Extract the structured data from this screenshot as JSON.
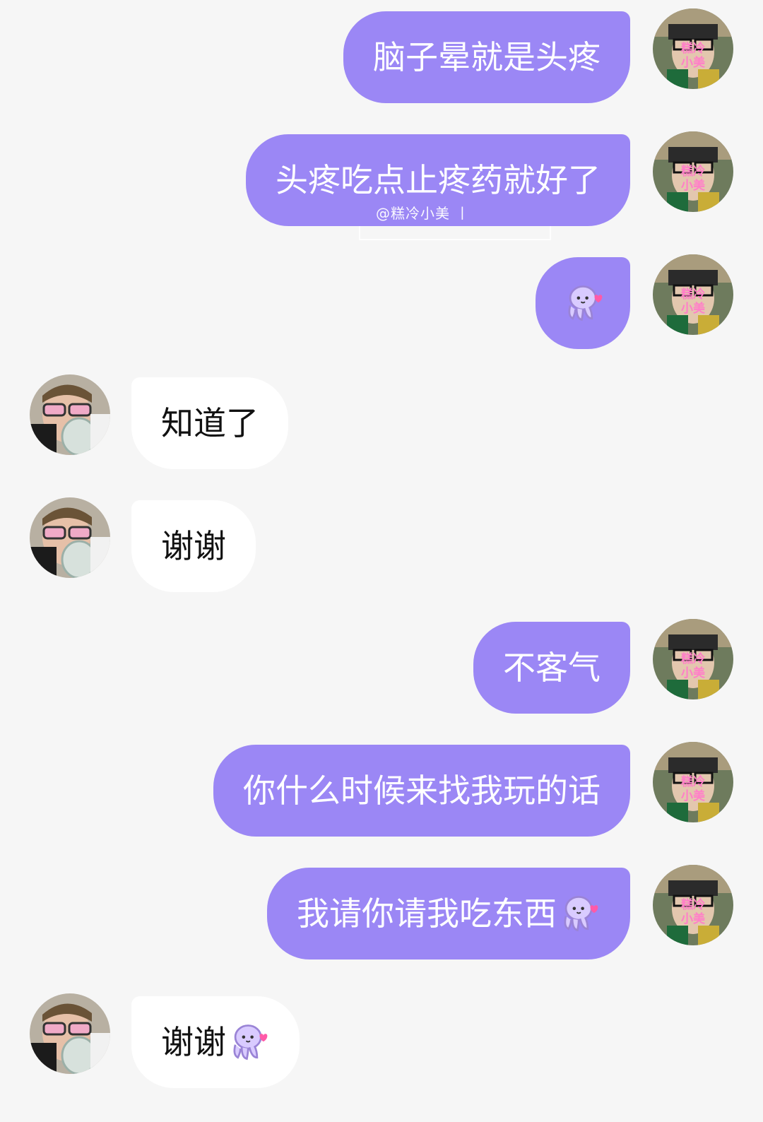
{
  "colors": {
    "background": "#f6f6f6",
    "my_bubble": "#9b87f5",
    "other_bubble": "#ffffff",
    "other_text": "#111111"
  },
  "watermark": {
    "text": "@糕冷小美 丨"
  },
  "avatars": {
    "me": {
      "overlay_text": "糕冷\n小美",
      "icon": "avatar-me"
    },
    "other": {
      "icon": "avatar-other"
    }
  },
  "messages": [
    {
      "sender": "me",
      "text": "脑子晕就是头疼"
    },
    {
      "sender": "me",
      "text": "头疼吃点止疼药就好了"
    },
    {
      "sender": "me",
      "text": "",
      "sticker": "octopus-kiss-icon"
    },
    {
      "sender": "other",
      "text": "知道了"
    },
    {
      "sender": "other",
      "text": "谢谢"
    },
    {
      "sender": "me",
      "text": "不客气"
    },
    {
      "sender": "me",
      "text": "你什么时候来找我玩的话"
    },
    {
      "sender": "me",
      "text": "我请你请我吃东西",
      "sticker": "octopus-kiss-icon"
    },
    {
      "sender": "other",
      "text": "谢谢",
      "sticker": "octopus-kiss-icon"
    }
  ]
}
